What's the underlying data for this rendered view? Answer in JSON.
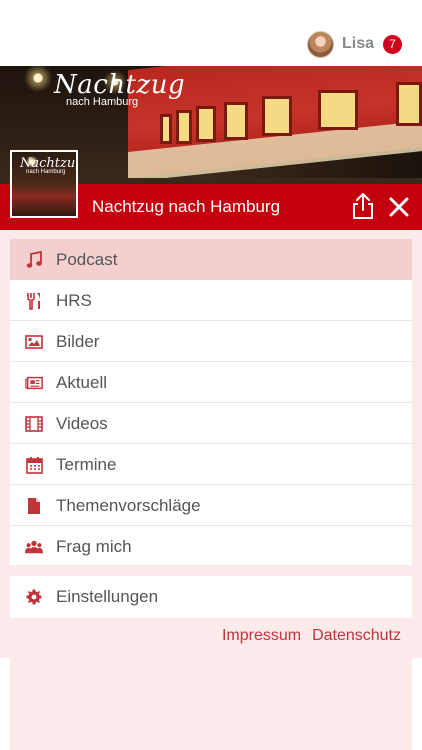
{
  "user": {
    "name": "Lisa",
    "notification_count": "7"
  },
  "hero": {
    "logo_title": "Nachtzug",
    "logo_subtitle": "nach Hamburg"
  },
  "channel": {
    "title": "Nachtzug nach Hamburg",
    "thumb_title": "Nachtzug",
    "thumb_subtitle": "nach Hamburg"
  },
  "menu": {
    "items": [
      {
        "label": "Podcast",
        "icon": "music-note-icon",
        "active": true
      },
      {
        "label": "HRS",
        "icon": "cutlery-icon",
        "active": false
      },
      {
        "label": "Bilder",
        "icon": "image-icon",
        "active": false
      },
      {
        "label": "Aktuell",
        "icon": "newspaper-icon",
        "active": false
      },
      {
        "label": "Videos",
        "icon": "film-icon",
        "active": false
      },
      {
        "label": "Termine",
        "icon": "calendar-icon",
        "active": false
      },
      {
        "label": "Themenvorschläge",
        "icon": "document-icon",
        "active": false
      },
      {
        "label": "Frag mich",
        "icon": "users-icon",
        "active": false
      }
    ],
    "settings_label": "Einstellungen"
  },
  "footer": {
    "impressum": "Impressum",
    "datenschutz": "Datenschutz"
  },
  "colors": {
    "accent": "#c4000f",
    "icon": "#c0343c",
    "active_row": "#f4cfcf",
    "background": "#fbeaea",
    "badge": "#d0021b"
  }
}
